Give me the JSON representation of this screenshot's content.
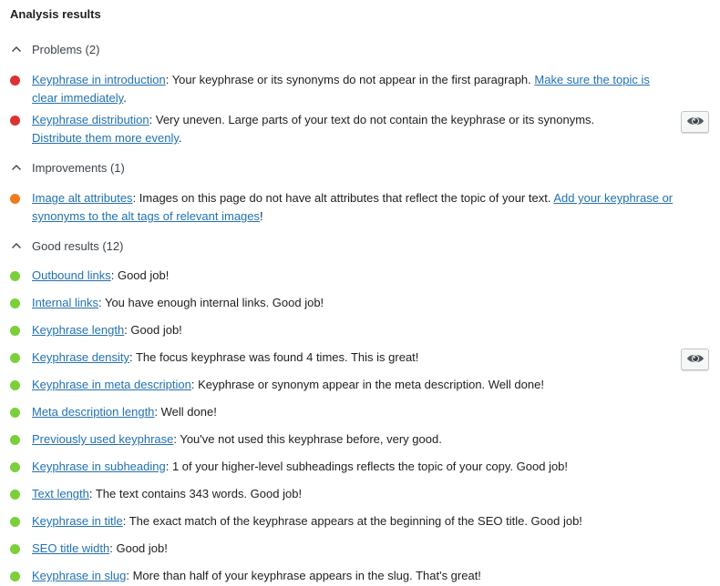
{
  "title": "Analysis results",
  "colors": {
    "problem": "#dc3232",
    "improvement": "#ee7c1b",
    "good": "#7ad03a",
    "link": "#2271b1"
  },
  "sections": {
    "problems": {
      "label": "Problems (2)",
      "icon": "chevron-up-icon",
      "items": [
        {
          "link": "Keyphrase in introduction",
          "text": ": Your keyphrase or its synonyms do not appear in the first paragraph. ",
          "action_link": "Make sure the topic is clear immediately",
          "suffix": "."
        },
        {
          "link": "Keyphrase distribution",
          "text": ": Very uneven. Large parts of your text do not contain the keyphrase or its synonyms. ",
          "action_link": "Distribute them more evenly",
          "suffix": ".",
          "has_eye_button": true
        }
      ]
    },
    "improvements": {
      "label": "Improvements (1)",
      "icon": "chevron-up-icon",
      "items": [
        {
          "link": "Image alt attributes",
          "text": ": Images on this page do not have alt attributes that reflect the topic of your text. ",
          "action_link": "Add your keyphrase or synonyms to the alt tags of relevant images",
          "suffix": "!"
        }
      ]
    },
    "good": {
      "label": "Good results (12)",
      "icon": "chevron-up-icon",
      "items": [
        {
          "link": "Outbound links",
          "text": ": Good job!"
        },
        {
          "link": "Internal links",
          "text": ": You have enough internal links. Good job!"
        },
        {
          "link": "Keyphrase length",
          "text": ": Good job!"
        },
        {
          "link": "Keyphrase density",
          "text": ": The focus keyphrase was found 4 times. This is great!",
          "has_eye_button": true
        },
        {
          "link": "Keyphrase in meta description",
          "text": ": Keyphrase or synonym appear in the meta description. Well done!"
        },
        {
          "link": "Meta description length",
          "text": ": Well done!"
        },
        {
          "link": "Previously used keyphrase",
          "text": ": You've not used this keyphrase before, very good."
        },
        {
          "link": "Keyphrase in subheading",
          "text": ": 1 of your higher-level subheadings reflects the topic of your copy. Good job!"
        },
        {
          "link": "Text length",
          "text": ": The text contains 343 words. Good job!"
        },
        {
          "link": "Keyphrase in title",
          "text": ": The exact match of the keyphrase appears at the beginning of the SEO title. Good job!"
        },
        {
          "link": "SEO title width",
          "text": ": Good job!"
        },
        {
          "link": "Keyphrase in slug",
          "text": ": More than half of your keyphrase appears in the slug. That's great!"
        }
      ]
    }
  }
}
